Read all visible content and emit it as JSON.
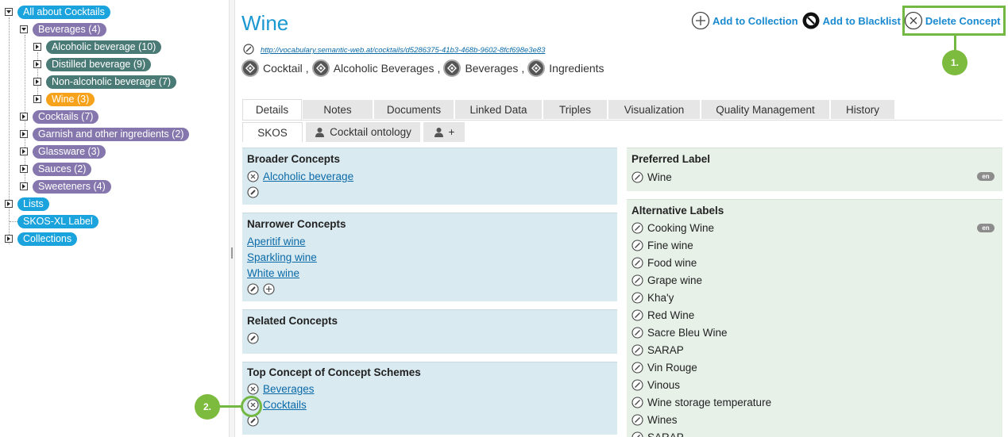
{
  "tree": {
    "root": "All about Cocktails",
    "beverages": "Beverages (4)",
    "alcoholic": "Alcoholic beverage (10)",
    "distilled": "Distilled beverage (9)",
    "nonalcoholic": "Non-alcoholic beverage (7)",
    "wine": "Wine (3)",
    "cocktails": "Cocktails (7)",
    "garnish": "Garnish and other ingredients (2)",
    "glassware": "Glassware (3)",
    "sauces": "Sauces (2)",
    "sweeteners": "Sweeteners (4)",
    "lists": "Lists",
    "skosxl": "SKOS-XL Label",
    "collections": "Collections"
  },
  "header": {
    "title": "Wine",
    "uri": "http://vocabulary.semantic-web.at/cocktails/d5286375-41b3-468b-9602-8fcf698e3e83",
    "breadcrumbs": [
      "Cocktail",
      "Alcoholic Beverages",
      "Beverages",
      "Ingredients"
    ],
    "separator": ","
  },
  "actions": {
    "add_collection": "Add to Collection",
    "add_blacklist": "Add to Blacklist",
    "delete": "Delete Concept"
  },
  "callouts": {
    "one": "1.",
    "two": "2."
  },
  "tabs": [
    "Details",
    "Notes",
    "Documents",
    "Linked Data",
    "Triples",
    "Visualization",
    "Quality Management",
    "History"
  ],
  "subtabs": {
    "skos": "SKOS",
    "ontology": "Cocktail ontology",
    "add": "+"
  },
  "left": {
    "broader": {
      "title": "Broader Concepts",
      "items": [
        "Alcoholic beverage"
      ]
    },
    "narrower": {
      "title": "Narrower Concepts",
      "items": [
        "Aperitif wine",
        "Sparkling wine",
        "White wine"
      ]
    },
    "related": {
      "title": "Related Concepts"
    },
    "top": {
      "title": "Top Concept of Concept Schemes",
      "items": [
        "Beverages",
        "Cocktails"
      ]
    }
  },
  "right": {
    "preferred": {
      "title": "Preferred Label",
      "value": "Wine",
      "lang": "en"
    },
    "alternative": {
      "title": "Alternative Labels",
      "lang": "en",
      "items": [
        "Cooking Wine",
        "Fine wine",
        "Food wine",
        "Grape wine",
        "Kha'y",
        "Red Wine",
        "Sacre Bleu Wine",
        "SARAP",
        "Vin Rouge",
        "Vinous",
        "Wine storage temperature",
        "Wines",
        "SARAP"
      ]
    }
  },
  "colors": {
    "accent": "#1a98d2",
    "callout": "#7cbb3d",
    "panel_left": "#daeaf1",
    "panel_right": "#e7f1e8"
  }
}
